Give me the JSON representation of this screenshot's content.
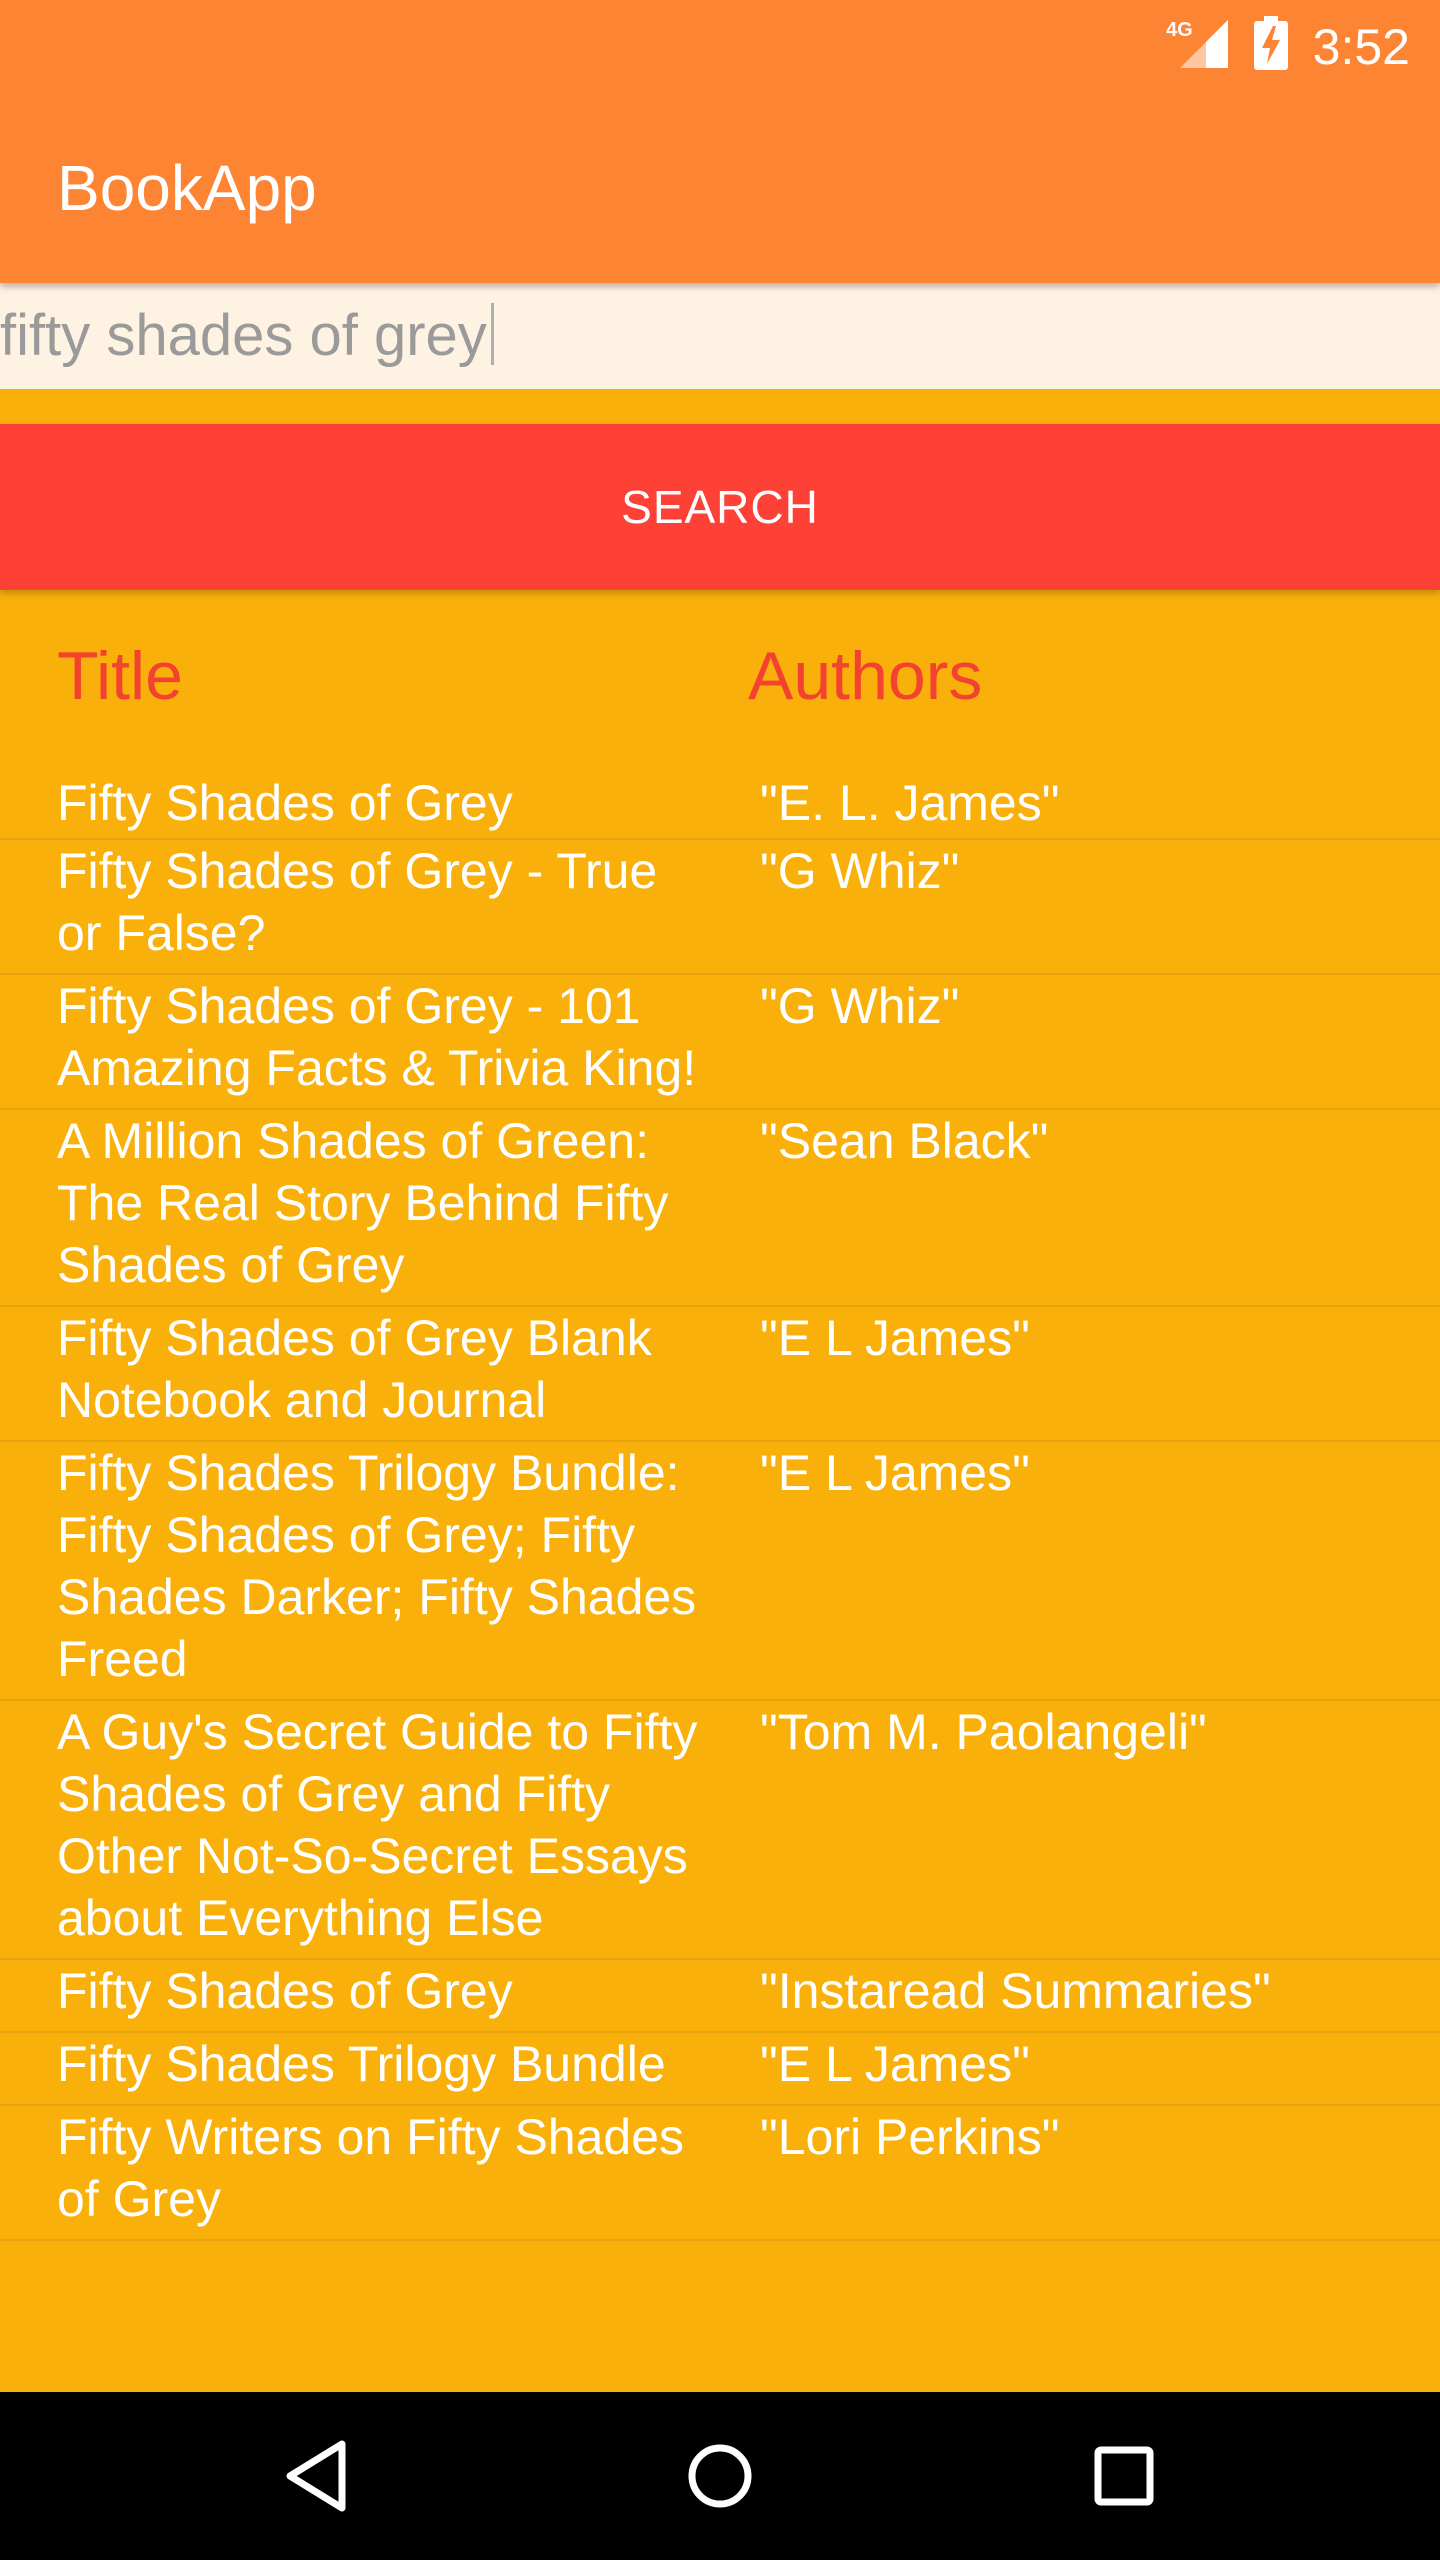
{
  "status_bar": {
    "network": "4G",
    "time": "3:52"
  },
  "app": {
    "title": "BookApp"
  },
  "search": {
    "query": "fifty shades of grey",
    "button_label": "SEARCH"
  },
  "table": {
    "headers": [
      "Title",
      "Authors"
    ],
    "rows": [
      {
        "title": "Fifty Shades of Grey",
        "author": "\"E. L. James\""
      },
      {
        "title": "Fifty Shades of Grey - True or False?",
        "author": "\"G Whiz\""
      },
      {
        "title": "Fifty Shades of Grey - 101 Amazing Facts & Trivia King!",
        "author": "\"G Whiz\""
      },
      {
        "title": "A Million Shades of Green: The Real Story Behind Fifty Shades of Grey",
        "author": "\"Sean Black\""
      },
      {
        "title": "Fifty Shades of Grey Blank Notebook and Journal",
        "author": "\"E L James\""
      },
      {
        "title": "Fifty Shades Trilogy Bundle: Fifty Shades of Grey; Fifty Shades Darker; Fifty Shades Freed",
        "author": "\"E L James\""
      },
      {
        "title": "A Guy's Secret Guide to Fifty Shades of Grey and Fifty Other Not-So-Secret Essays about Everything Else",
        "author": "\"Tom M. Paolangeli\""
      },
      {
        "title": "Fifty Shades of Grey",
        "author": "\"Instaread Summaries\""
      },
      {
        "title": "Fifty Shades Trilogy Bundle",
        "author": "\"E L James\""
      },
      {
        "title": "Fifty Writers on Fifty Shades of Grey",
        "author": "\"Lori Perkins\""
      }
    ]
  },
  "colors": {
    "app_bar": "#FD8432",
    "background": "#F9B00B",
    "search_button": "#FE4137",
    "header_text": "#F3422F",
    "input_background": "#FEF2E2"
  },
  "nav": {
    "icons": [
      "back-icon",
      "home-icon",
      "recents-icon"
    ]
  }
}
